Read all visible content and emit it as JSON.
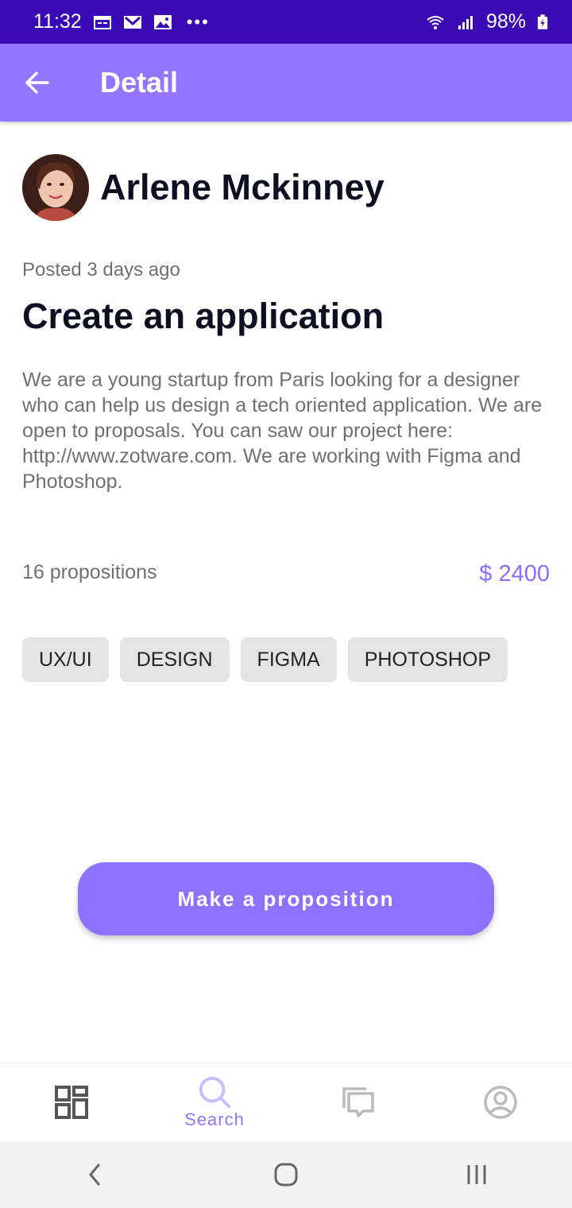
{
  "status_bar": {
    "time": "11:32",
    "battery": "98%",
    "notification_icons": [
      "calendar-icon",
      "gmail-icon",
      "gallery-icon"
    ],
    "more": "•••"
  },
  "app_bar": {
    "title": "Detail",
    "color": "#9375ff"
  },
  "author": {
    "name": "Arlene Mckinney"
  },
  "job": {
    "posted": "Posted 3 days ago",
    "title": "Create an application",
    "description": "We are a young startup from Paris looking for a designer who can help us design a tech oriented application. We are open to proposals. You can saw our project here: http://www.zotware.com. We are working with Figma and Photoshop.",
    "propositions": "16 propositions",
    "price": "$ 2400",
    "tags": [
      "UX/UI",
      "DESIGN",
      "FIGMA",
      "PHOTOSHOP"
    ]
  },
  "cta": {
    "label": "Make a proposition"
  },
  "bottom_nav": {
    "items": [
      {
        "icon": "dashboard-icon",
        "label": ""
      },
      {
        "icon": "search-icon",
        "label": "Search",
        "active": true
      },
      {
        "icon": "chat-icon",
        "label": ""
      },
      {
        "icon": "profile-icon",
        "label": ""
      }
    ],
    "active_color": "#9375ff"
  }
}
